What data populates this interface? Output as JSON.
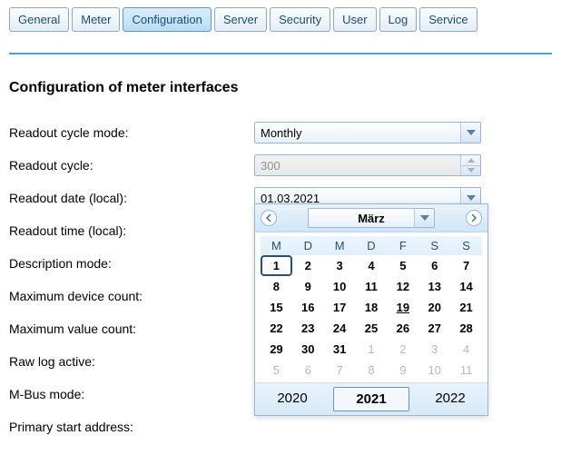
{
  "tabs": [
    "General",
    "Meter",
    "Configuration",
    "Server",
    "Security",
    "User",
    "Log",
    "Service"
  ],
  "active_tab_index": 2,
  "title": "Configuration of meter interfaces",
  "labels": {
    "readout_cycle_mode": "Readout cycle mode:",
    "readout_cycle": "Readout cycle:",
    "readout_date": "Readout date (local):",
    "readout_time": "Readout time (local):",
    "description_mode": "Description mode:",
    "max_device_count": "Maximum device count:",
    "max_value_count": "Maximum value count:",
    "raw_log_active": "Raw log active:",
    "mbus_mode": "M-Bus mode:",
    "primary_start_address": "Primary start address:"
  },
  "values": {
    "readout_cycle_mode": "Monthly",
    "readout_cycle": "300",
    "readout_date": "01.03.2021"
  },
  "calendar": {
    "month_label": "März",
    "dow": [
      "M",
      "D",
      "M",
      "D",
      "F",
      "S",
      "S"
    ],
    "weeks": [
      [
        {
          "d": 1,
          "sel": true
        },
        {
          "d": 2
        },
        {
          "d": 3
        },
        {
          "d": 4
        },
        {
          "d": 5
        },
        {
          "d": 6
        },
        {
          "d": 7
        }
      ],
      [
        {
          "d": 8
        },
        {
          "d": 9
        },
        {
          "d": 10
        },
        {
          "d": 11
        },
        {
          "d": 12
        },
        {
          "d": 13
        },
        {
          "d": 14
        }
      ],
      [
        {
          "d": 15
        },
        {
          "d": 16
        },
        {
          "d": 17
        },
        {
          "d": 18
        },
        {
          "d": 19,
          "today": true
        },
        {
          "d": 20
        },
        {
          "d": 21
        }
      ],
      [
        {
          "d": 22
        },
        {
          "d": 23
        },
        {
          "d": 24
        },
        {
          "d": 25
        },
        {
          "d": 26
        },
        {
          "d": 27
        },
        {
          "d": 28
        }
      ],
      [
        {
          "d": 29
        },
        {
          "d": 30
        },
        {
          "d": 31
        },
        {
          "d": 1,
          "o": true
        },
        {
          "d": 2,
          "o": true
        },
        {
          "d": 3,
          "o": true
        },
        {
          "d": 4,
          "o": true
        }
      ],
      [
        {
          "d": 5,
          "o": true
        },
        {
          "d": 6,
          "o": true
        },
        {
          "d": 7,
          "o": true
        },
        {
          "d": 8,
          "o": true
        },
        {
          "d": 9,
          "o": true
        },
        {
          "d": 10,
          "o": true
        },
        {
          "d": 11,
          "o": true
        }
      ]
    ],
    "years": [
      "2020",
      "2021",
      "2022"
    ],
    "current_year_index": 1
  }
}
